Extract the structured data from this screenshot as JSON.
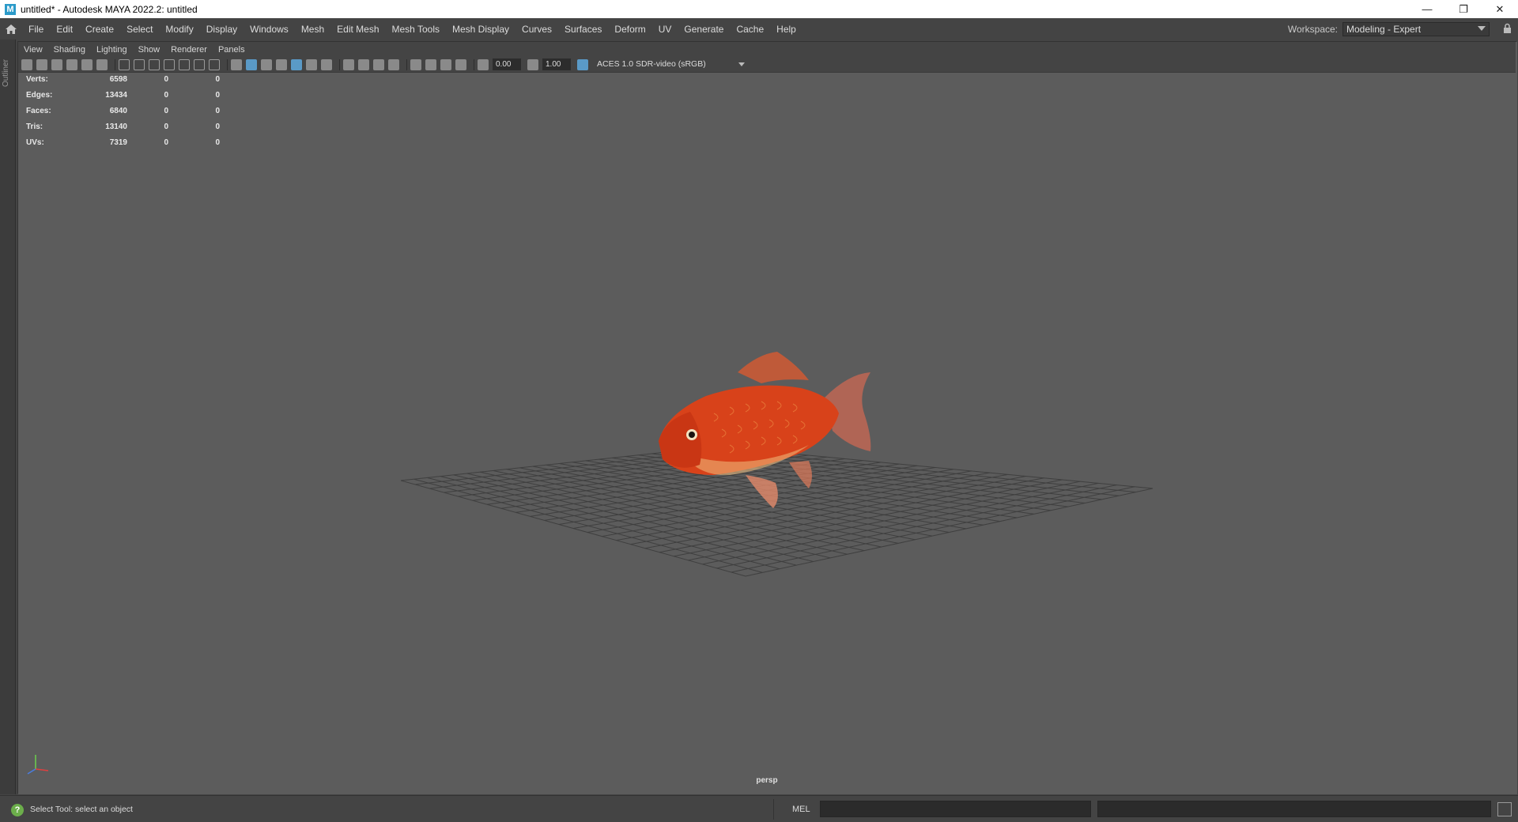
{
  "window": {
    "title": "untitled* - Autodesk MAYA 2022.2: untitled",
    "logo": "M",
    "controls": [
      "minimize-icon",
      "restore-icon",
      "close-icon"
    ]
  },
  "menubar": {
    "items": [
      "File",
      "Edit",
      "Create",
      "Select",
      "Modify",
      "Display",
      "Windows",
      "Mesh",
      "Edit Mesh",
      "Mesh Tools",
      "Mesh Display",
      "Curves",
      "Surfaces",
      "Deform",
      "UV",
      "Generate",
      "Cache",
      "Help"
    ],
    "workspace_label": "Workspace:",
    "workspace_value": "Modeling - Expert"
  },
  "outliner": {
    "label": "Outliner"
  },
  "panel": {
    "menu": [
      "View",
      "Shading",
      "Lighting",
      "Show",
      "Renderer",
      "Panels"
    ],
    "exposure": "0.00",
    "gamma": "1.00",
    "color_space": "ACES 1.0 SDR-video (sRGB)",
    "camera": "persp"
  },
  "hud": {
    "rows": [
      {
        "label": "Verts:",
        "v1": "6598",
        "v2": "0",
        "v3": "0"
      },
      {
        "label": "Edges:",
        "v1": "13434",
        "v2": "0",
        "v3": "0"
      },
      {
        "label": "Faces:",
        "v1": "6840",
        "v2": "0",
        "v3": "0"
      },
      {
        "label": "Tris:",
        "v1": "13140",
        "v2": "0",
        "v3": "0"
      },
      {
        "label": "UVs:",
        "v1": "7319",
        "v2": "0",
        "v3": "0"
      }
    ]
  },
  "statusbar": {
    "message": "Select Tool: select an object",
    "language": "MEL"
  },
  "colors": {
    "viewport_bg": "#5c5c5c",
    "ui_bg": "#444444",
    "grid": "#3f3f3f",
    "fish_body": "#d8421a",
    "accent": "#5a9ac7"
  }
}
